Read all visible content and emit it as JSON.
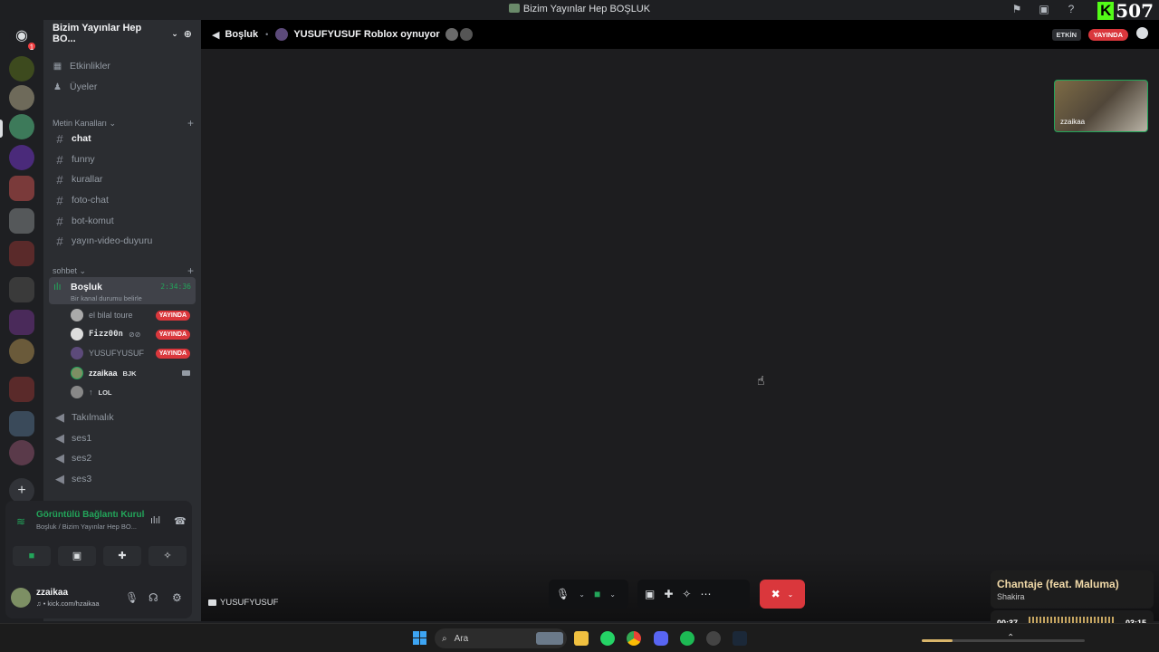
{
  "window": {
    "title": "Bizim Yayınlar Hep BOŞLUK"
  },
  "kick": {
    "letter": "K",
    "count": "507"
  },
  "guilds": {
    "notif_badge": "1",
    "add_label": "+"
  },
  "server": {
    "name": "Bizim Yayınlar Hep BO..."
  },
  "nav": {
    "events": "Etkinlikler",
    "members": "Üyeler"
  },
  "categories": {
    "text": "Metin Kanalları",
    "voice": "sohbet"
  },
  "text_channels": [
    "chat",
    "funny",
    "kurallar",
    "foto-chat",
    "bot-komut",
    "yayın-video-duyuru"
  ],
  "active_voice": {
    "name": "Boşluk",
    "status": "Bir kanal durumu belirle",
    "timer": "2:34:36"
  },
  "voice_users": [
    {
      "name": "el bilal toure",
      "live": "YAYINDA"
    },
    {
      "name": "Fizz00n",
      "live": "YAYINDA"
    },
    {
      "name": "YUSUFYUSUF",
      "live": "YAYINDA"
    },
    {
      "name": "zzaikaa",
      "tag": "BJK"
    },
    {
      "name": "↑",
      "tag": "LOL"
    }
  ],
  "voice_channels": [
    "Takılmalık",
    "ses1",
    "ses2",
    "ses3"
  ],
  "connection": {
    "title": "Görüntülü Bağlantı Kuruldu",
    "subtitle": "Boşluk / Bizim Yayınlar Hep BO..."
  },
  "user": {
    "name": "zzaikaa",
    "status": "♫ • kick.com/hzaikaa"
  },
  "topbar": {
    "channel": "Boşluk",
    "activity": "YUSUFYUSUF Roblox oynuyor",
    "etkin": "ETKİN",
    "live": "YAYINDA"
  },
  "stage": {
    "pip_name": "zzaikaa",
    "streamer": "YUSUFYUSUF"
  },
  "now_playing": {
    "song": "Chantaje (feat. Maluma)",
    "artist": "Shakira",
    "elapsed": "00:37",
    "duration": "03:15",
    "progress": 0.19
  },
  "taskbar": {
    "search": "Ara"
  }
}
